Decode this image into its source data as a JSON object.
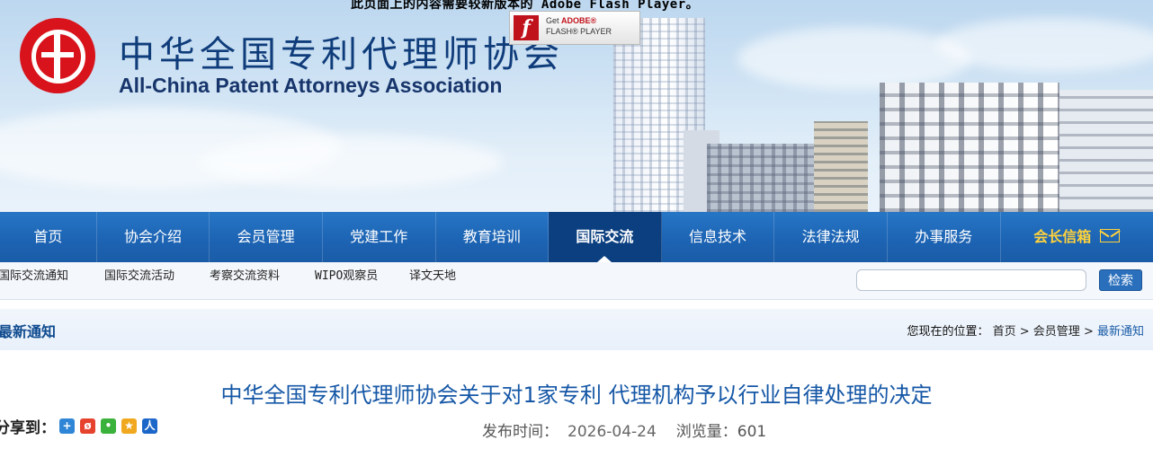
{
  "banner": {
    "flash_message": "此页面上的内容需要较新版本的 Adobe Flash Player。",
    "title_cn": "中华全国专利代理师协会",
    "title_en": "All-China Patent Attorneys Association",
    "flash_badge": {
      "line1_prefix": "Get ",
      "line1_brand": "ADOBE®",
      "line2": "FLASH® PLAYER"
    }
  },
  "nav": {
    "items": [
      {
        "label": "首页"
      },
      {
        "label": "协会介绍"
      },
      {
        "label": "会员管理"
      },
      {
        "label": "党建工作"
      },
      {
        "label": "教育培训"
      },
      {
        "label": "国际交流",
        "active": true
      },
      {
        "label": "信息技术"
      },
      {
        "label": "法律法规"
      },
      {
        "label": "办事服务"
      }
    ],
    "mailbox_label": "会长信箱"
  },
  "subnav": {
    "items": [
      {
        "label": "国际交流通知"
      },
      {
        "label": "国际交流活动"
      },
      {
        "label": "考察交流资料"
      },
      {
        "label": "WIPO观察员"
      },
      {
        "label": "译文天地"
      }
    ],
    "search_value": "",
    "search_button": "检索"
  },
  "crumbbar": {
    "section_title": "最新通知",
    "lead": "您现在的位置：",
    "path": [
      "首页",
      "会员管理"
    ],
    "current": "最新通知",
    "separator": " > "
  },
  "article": {
    "title": "中华全国专利代理师协会关于对1家专利 代理机构予以行业自律处理的决定",
    "share_label": "分享到：",
    "share_icons": [
      "qzone-icon",
      "weibo-icon",
      "wechat-icon",
      "tencent-weibo-icon",
      "renren-icon"
    ],
    "publish_label": "发布时间：",
    "publish_date": "2026-04-24",
    "views_label": "浏览量：",
    "views": "601"
  },
  "colors": {
    "nav_bg": "#1d64b4",
    "nav_active": "#0b3f80",
    "mailbox": "#ffd23c",
    "title_blue": "#1557a6",
    "logo_red": "#d8131b"
  }
}
